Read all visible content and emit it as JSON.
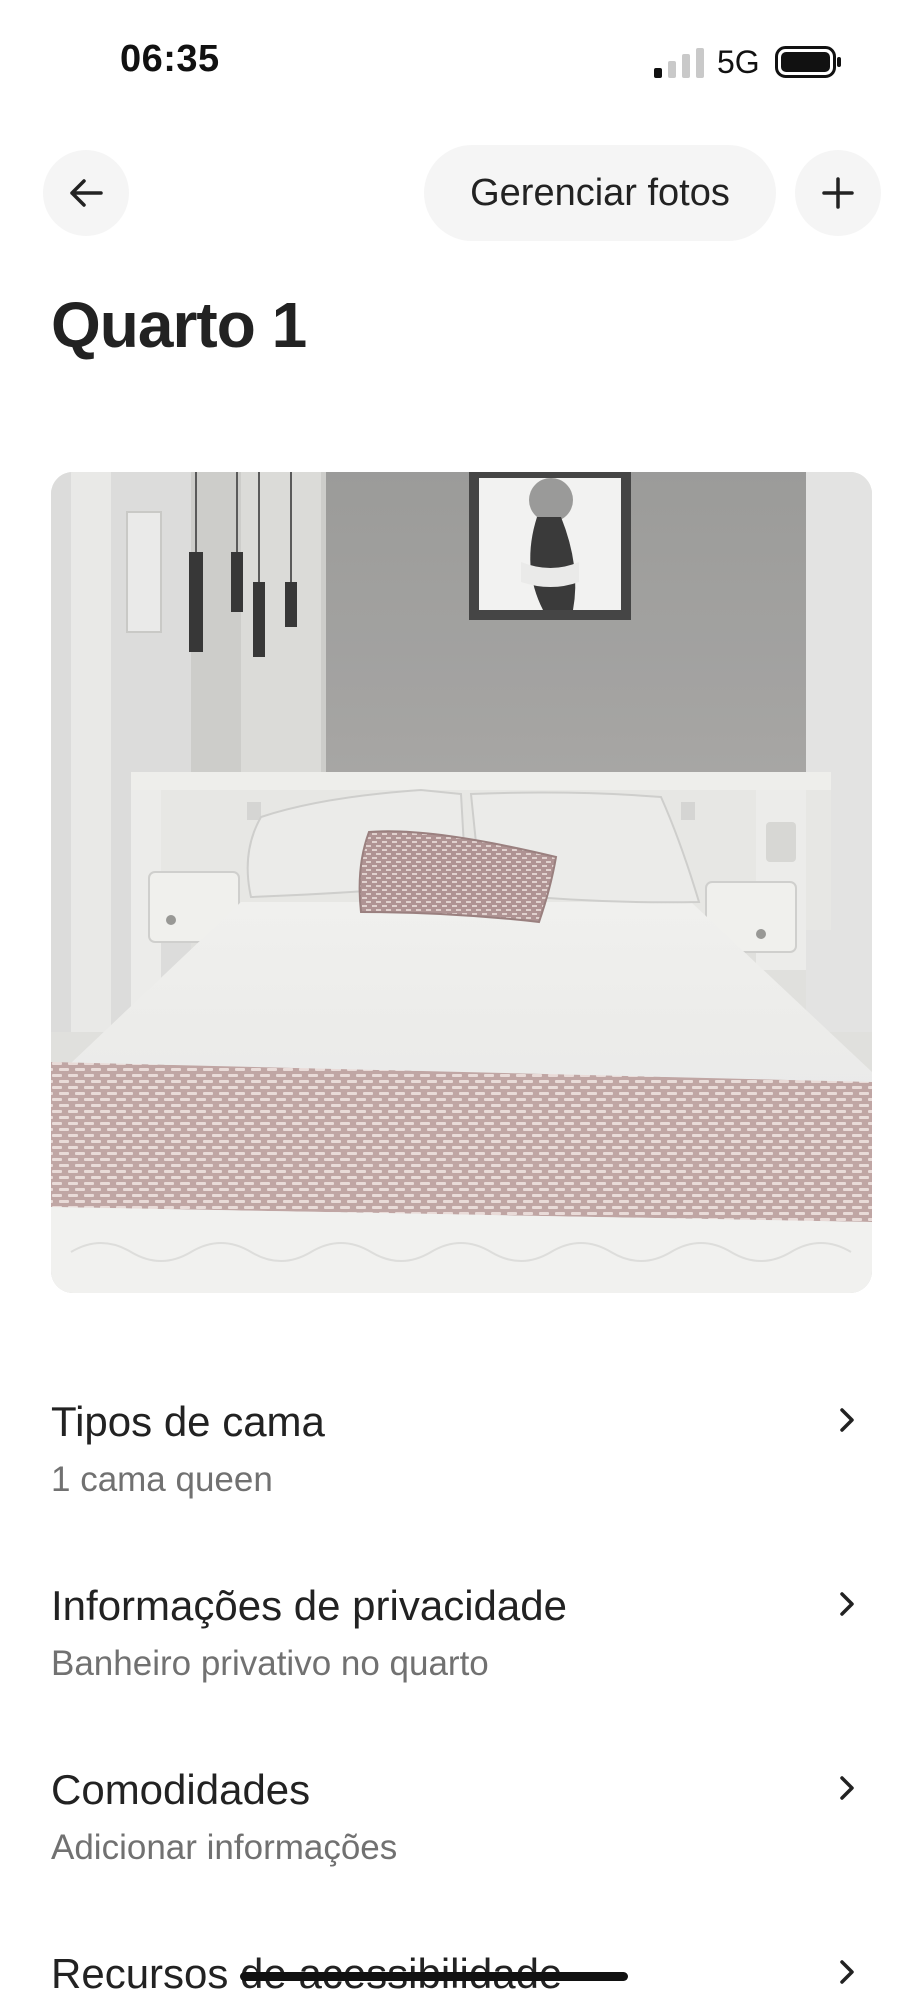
{
  "status_bar": {
    "time": "06:35",
    "network": "5G"
  },
  "header": {
    "back_icon": "arrow-left-icon",
    "manage_photos_label": "Gerenciar fotos",
    "add_icon": "plus-icon"
  },
  "page": {
    "title": "Quarto 1"
  },
  "photo": {
    "subject": "bedroom-photo"
  },
  "sections": [
    {
      "title": "Tipos de cama",
      "subtitle": "1 cama queen"
    },
    {
      "title": "Informações de privacidade",
      "subtitle": "Banheiro privativo no quarto"
    },
    {
      "title": "Comodidades",
      "subtitle": "Adicionar informações"
    },
    {
      "title": "Recursos de acessibilidade",
      "subtitle": ""
    }
  ],
  "colors": {
    "text_primary": "#222222",
    "text_secondary": "#717171",
    "button_bg": "#f5f5f5"
  }
}
